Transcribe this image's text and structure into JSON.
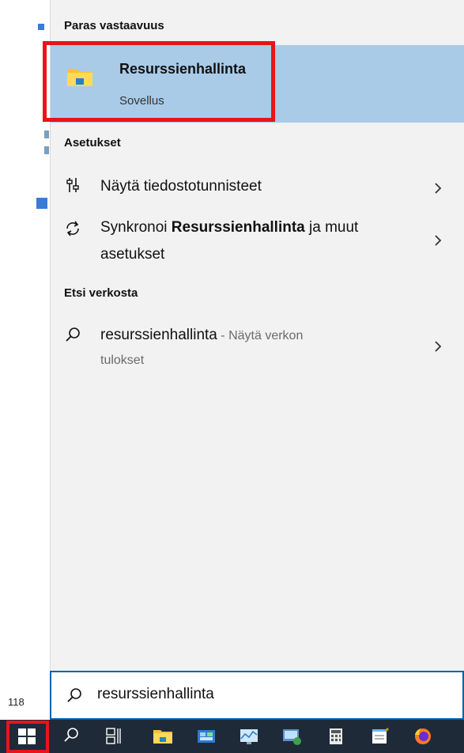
{
  "desktop": {
    "number": "118"
  },
  "panel": {
    "best_match_header": "Paras vastaavuus",
    "best_match": {
      "title": "Resurssienhallinta",
      "subtitle": "Sovellus"
    },
    "settings_header": "Asetukset",
    "settings_items": [
      {
        "label": "Näytä tiedostotunnisteet",
        "icon": "settings-slider-icon"
      },
      {
        "label_prefix": "Synkronoi ",
        "label_bold": "Resurssienhallinta",
        "label_suffix": " ja muut",
        "label_line2": "asetukset",
        "icon": "sync-icon"
      }
    ],
    "web_header": "Etsi verkosta",
    "web_items": [
      {
        "query": "resurssienhallinta",
        "suffix": " - Näytä verkon",
        "line2": "tulokset",
        "icon": "search-icon"
      }
    ]
  },
  "search_box": {
    "value": "resurssienhallinta",
    "icon": "search-icon"
  },
  "taskbar": {
    "items": [
      "start-icon",
      "search-icon",
      "task-view-icon",
      "file-explorer-icon",
      "control-panel-icon",
      "performance-monitor-icon",
      "remote-desktop-icon",
      "calculator-icon",
      "notepad-icon",
      "firefox-icon"
    ]
  },
  "colors": {
    "accent_highlight": "#a9cbe8",
    "annotation_red": "#e8141c",
    "taskbar_bg": "#1f2a38",
    "search_border": "#0063b1"
  }
}
